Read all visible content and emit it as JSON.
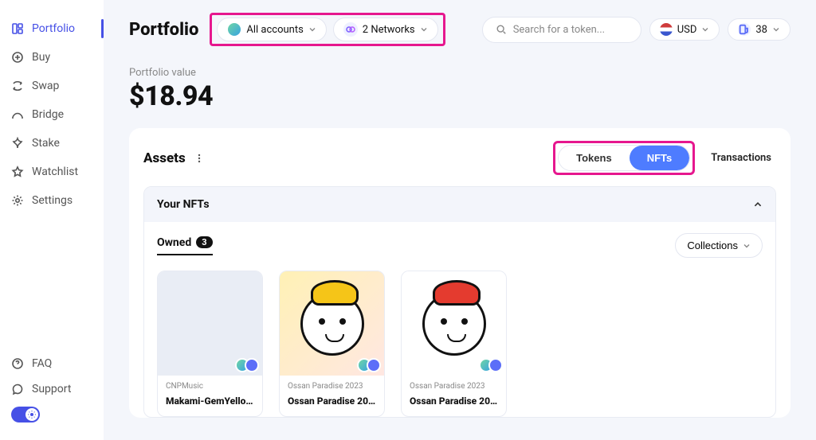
{
  "sidebar": {
    "items": [
      {
        "label": "Portfolio"
      },
      {
        "label": "Buy"
      },
      {
        "label": "Swap"
      },
      {
        "label": "Bridge"
      },
      {
        "label": "Stake"
      },
      {
        "label": "Watchlist"
      },
      {
        "label": "Settings"
      }
    ],
    "bottom": [
      {
        "label": "FAQ"
      },
      {
        "label": "Support"
      }
    ]
  },
  "header": {
    "title": "Portfolio",
    "accounts_label": "All accounts",
    "networks_label": "2 Networks",
    "search_placeholder": "Search for a token...",
    "currency_label": "USD",
    "gas_value": "38"
  },
  "portfolio": {
    "value_label": "Portfolio value",
    "value": "$18.94"
  },
  "assets": {
    "title": "Assets",
    "tabs": {
      "tokens": "Tokens",
      "nfts": "NFTs",
      "transactions": "Transactions"
    },
    "your_nfts": "Your NFTs",
    "owned_label": "Owned",
    "owned_count": "3",
    "collections_label": "Collections",
    "cards": [
      {
        "collection": "CNPMusic",
        "title": "Makami-GemYellow #..."
      },
      {
        "collection": "Ossan Paradise 2023",
        "title": "Ossan Paradise 2023 ..."
      },
      {
        "collection": "Ossan Paradise 2023",
        "title": "Ossan Paradise 2023 ..."
      }
    ]
  }
}
